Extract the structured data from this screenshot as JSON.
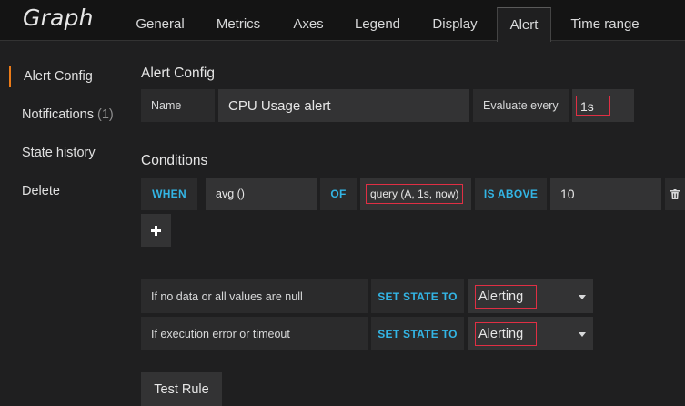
{
  "header": {
    "title": "Graph",
    "tabs": [
      "General",
      "Metrics",
      "Axes",
      "Legend",
      "Display",
      "Alert",
      "Time range"
    ],
    "active_tab": "Alert"
  },
  "sidebar": {
    "items": [
      {
        "label": "Alert Config",
        "active": true
      },
      {
        "label": "Notifications",
        "count": "(1)"
      },
      {
        "label": "State history"
      },
      {
        "label": "Delete"
      }
    ]
  },
  "alert_config": {
    "title": "Alert Config",
    "name_label": "Name",
    "name_value": "CPU Usage alert",
    "evaluate_label": "Evaluate every",
    "evaluate_value": "1s"
  },
  "conditions": {
    "title": "Conditions",
    "when": "WHEN",
    "reducer": "avg ()",
    "of": "OF",
    "query": "query (A, 1s, now)",
    "evaluator": "IS ABOVE",
    "threshold": "10",
    "delete_icon": "trash-icon",
    "add_icon": "plus-icon"
  },
  "no_data": {
    "nodata_label": "If no data or all values are null",
    "nodata_set": "SET STATE TO",
    "nodata_value": "Alerting",
    "error_label": "If execution error or timeout",
    "error_set": "SET STATE TO",
    "error_value": "Alerting"
  },
  "test_rule": {
    "label": "Test Rule"
  },
  "colors": {
    "accent": "#eb7b18",
    "keyword": "#33b5e5",
    "highlight_box": "#e02f44"
  }
}
